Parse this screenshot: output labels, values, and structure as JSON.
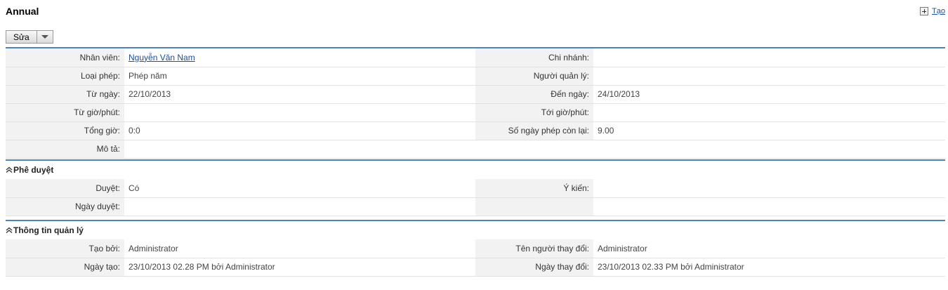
{
  "header": {
    "title": "Annual",
    "create_label": "Tạo"
  },
  "toolbar": {
    "edit_label": "Sửa"
  },
  "main": {
    "rows": [
      {
        "l1": "Nhân viên:",
        "v1": "Nguyễn Văn Nam",
        "l2": "Chi nhánh:",
        "v2": ""
      },
      {
        "l1": "Loại phép:",
        "v1": "Phép năm",
        "l2": "Người quản lý:",
        "v2": ""
      },
      {
        "l1": "Từ ngày:",
        "v1": "22/10/2013",
        "l2": "Đến ngày:",
        "v2": "24/10/2013"
      },
      {
        "l1": "Từ giờ/phút:",
        "v1": "",
        "l2": "Tới giờ/phút:",
        "v2": ""
      },
      {
        "l1": "Tổng giờ:",
        "v1": "0:0",
        "l2": "Số ngày phép còn lại:",
        "v2": "9.00"
      },
      {
        "l1": "Mô tả:",
        "v1": ""
      }
    ]
  },
  "approval": {
    "title": "Phê duyệt",
    "rows": [
      {
        "l1": "Duyệt:",
        "v1": "Có",
        "l2": "Ý kiến:",
        "v2": ""
      },
      {
        "l1": "Ngày duyệt:",
        "v1": "",
        "l2": "",
        "v2": ""
      }
    ]
  },
  "admin": {
    "title": "Thông tin quản lý",
    "rows": [
      {
        "l1": "Tạo bởi:",
        "v1": "Administrator",
        "l2": "Tên người thay đổi:",
        "v2": "Administrator"
      },
      {
        "l1": "Ngày tạo:",
        "v1": "23/10/2013 02.28 PM bởi Administrator",
        "l2": "Ngày thay đổi:",
        "v2": "23/10/2013 02.33 PM bởi Administrator"
      }
    ]
  }
}
